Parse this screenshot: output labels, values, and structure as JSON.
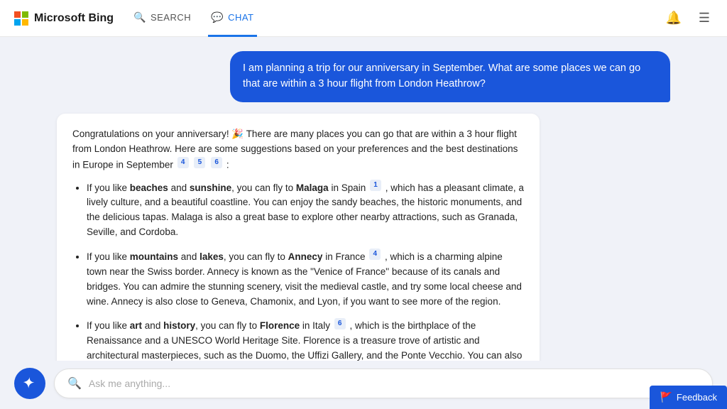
{
  "header": {
    "logo_text": "Microsoft Bing",
    "nav": {
      "search_label": "SEARCH",
      "chat_label": "CHAT"
    }
  },
  "user_message": "I am planning a trip for our anniversary in September. What are some places we can go that are within a 3 hour flight from London Heathrow?",
  "bot_response": {
    "intro": "Congratulations on your anniversary! 🎉 There are many places you can go that are within a 3 hour flight from London Heathrow. Here are some suggestions based on your preferences and the best destinations in Europe in September",
    "bullet1_pre": "If you like ",
    "bullet1_bold1": "beaches",
    "bullet1_mid1": " and ",
    "bullet1_bold2": "sunshine",
    "bullet1_post": ", you can fly to ",
    "bullet1_dest": "Malaga",
    "bullet1_country": " in Spain",
    "bullet1_detail": ", which has a pleasant climate, a lively culture, and a beautiful coastline. You can enjoy the sandy beaches, the historic monuments, and the delicious tapas. Malaga is also a great base to explore other nearby attractions, such as Granada, Seville, and Cordoba.",
    "bullet2_pre": "If you like ",
    "bullet2_bold1": "mountains",
    "bullet2_mid1": " and ",
    "bullet2_bold2": "lakes",
    "bullet2_post": ", you can fly to ",
    "bullet2_dest": "Annecy",
    "bullet2_country": " in France",
    "bullet2_detail": ", which is a charming alpine town near the Swiss border. Annecy is known as the \"Venice of France\" because of its canals and bridges. You can admire the stunning scenery, visit the medieval castle, and try some local cheese and wine. Annecy is also close to Geneva, Chamonix, and Lyon, if you want to see more of the region.",
    "bullet3_pre": "If you like ",
    "bullet3_bold1": "art",
    "bullet3_mid1": " and ",
    "bullet3_bold2": "history",
    "bullet3_post": ", you can fly to ",
    "bullet3_dest": "Florence",
    "bullet3_country": " in Italy",
    "bullet3_detail": ", which is the birthplace of the Renaissance and a UNESCO World Heritage Site. Florence is a treasure trove of artistic and architectural masterpieces, such as the Duomo, the Uffizi Gallery, and the Ponte Vecchio. You can also explore the Tuscan countryside, taste the famous gelato, and shop for leather goods."
  },
  "input": {
    "placeholder": "Ask me anything..."
  },
  "feedback": {
    "label": "Feedback"
  }
}
